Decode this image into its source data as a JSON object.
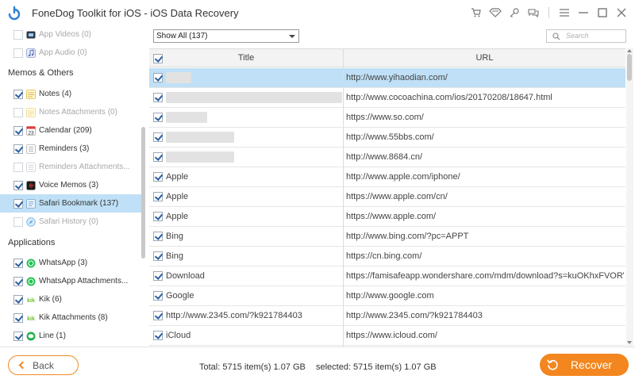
{
  "window": {
    "title": "FoneDog Toolkit for iOS - iOS Data Recovery",
    "icons": [
      "cart-icon",
      "wifi-icon",
      "key-icon",
      "chat-icon",
      "menu-icon",
      "minimize-icon",
      "maximize-icon",
      "close-icon"
    ]
  },
  "sidebar": {
    "items_top": [
      {
        "label": "App Videos (0)",
        "checked": false,
        "disabled": true,
        "icon": "video-icon"
      },
      {
        "label": "App Audio (0)",
        "checked": false,
        "disabled": true,
        "icon": "music-icon"
      }
    ],
    "section_memos": "Memos & Others",
    "items_memos": [
      {
        "label": "Notes (4)",
        "checked": true,
        "disabled": false,
        "icon": "notes-icon"
      },
      {
        "label": "Notes Attachments (0)",
        "checked": false,
        "disabled": true,
        "icon": "notes-icon"
      },
      {
        "label": "Calendar (209)",
        "checked": true,
        "disabled": false,
        "icon": "calendar-icon",
        "calendar_day": "23"
      },
      {
        "label": "Reminders (3)",
        "checked": true,
        "disabled": false,
        "icon": "reminders-icon"
      },
      {
        "label": "Reminders Attachments...",
        "checked": false,
        "disabled": true,
        "icon": "reminders-icon"
      },
      {
        "label": "Voice Memos (3)",
        "checked": true,
        "disabled": false,
        "icon": "voice-memo-icon"
      },
      {
        "label": "Safari Bookmark (137)",
        "checked": true,
        "disabled": false,
        "selected": true,
        "icon": "bookmark-icon"
      },
      {
        "label": "Safari History (0)",
        "checked": false,
        "disabled": true,
        "icon": "safari-icon"
      }
    ],
    "section_apps": "Applications",
    "items_apps": [
      {
        "label": "WhatsApp (3)",
        "checked": true,
        "disabled": false,
        "icon": "whatsapp-icon"
      },
      {
        "label": "WhatsApp Attachments...",
        "checked": true,
        "disabled": false,
        "icon": "whatsapp-icon"
      },
      {
        "label": "Kik (6)",
        "checked": true,
        "disabled": false,
        "icon": "kik-icon",
        "badge": "kik"
      },
      {
        "label": "Kik Attachments (8)",
        "checked": true,
        "disabled": false,
        "icon": "kik-icon",
        "badge": "kik"
      },
      {
        "label": "Line (1)",
        "checked": true,
        "disabled": false,
        "icon": "line-icon"
      }
    ]
  },
  "filter": {
    "selected": "Show All (137)",
    "search_placeholder": "Search"
  },
  "table": {
    "col_title": "Title",
    "col_url": "URL",
    "rows": [
      {
        "title": "",
        "blur": 32,
        "url": "http://www.yihaodian.com/",
        "selected": true
      },
      {
        "title": "",
        "blur": 222,
        "url": "http://www.cocoachina.com/ios/20170208/18647.html"
      },
      {
        "title": "",
        "blur": 52,
        "url": "https://www.so.com/"
      },
      {
        "title": "",
        "blur": 86,
        "url": "http://www.55bbs.com/"
      },
      {
        "title": "",
        "blur": 86,
        "url": "http://www.8684.cn/"
      },
      {
        "title": "Apple",
        "url": "http://www.apple.com/iphone/"
      },
      {
        "title": "Apple",
        "url": "https://www.apple.com/cn/"
      },
      {
        "title": "Apple",
        "url": "https://www.apple.com/"
      },
      {
        "title": "Bing",
        "url": "http://www.bing.com/?pc=APPT"
      },
      {
        "title": "Bing",
        "url": "https://cn.bing.com/"
      },
      {
        "title": "Download",
        "url": "https://famisafeapp.wondershare.com/mdm/download?s=kuOKhxFVORV..."
      },
      {
        "title": "Google",
        "url": "http://www.google.com"
      },
      {
        "title": "http://www.2345.com/?k921784403",
        "url": "http://www.2345.com/?k921784403"
      },
      {
        "title": "iCloud",
        "url": "https://www.icloud.com/"
      }
    ]
  },
  "footer": {
    "back_label": "Back",
    "total": "Total: 5715 item(s) 1.07 GB",
    "selected": "selected: 5715 item(s) 1.07 GB",
    "recover_label": "Recover"
  },
  "colors": {
    "accent": "#f3861f",
    "selection": "#bfe0f6",
    "checkmark": "#2c5f9e"
  }
}
